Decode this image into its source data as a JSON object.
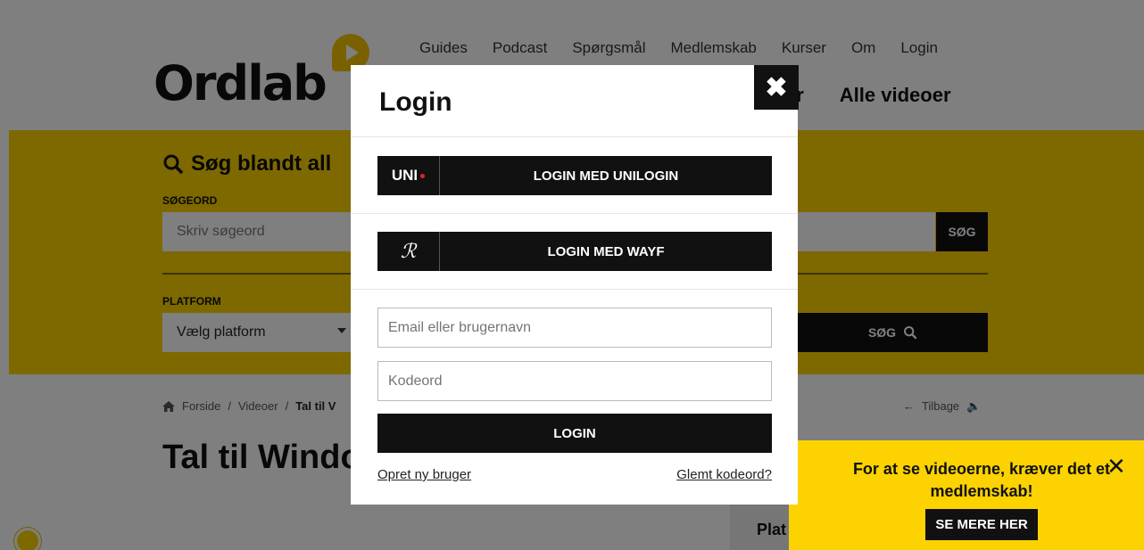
{
  "header": {
    "logo": "Ordlab",
    "topnav": [
      "Guides",
      "Podcast",
      "Spørgsmål",
      "Medlemskab",
      "Kurser",
      "Om",
      "Login"
    ],
    "subnav_partial": "er",
    "subnav_videos": "Alle videoer"
  },
  "search": {
    "title": "Søg blandt all",
    "keyword_label": "SØGEORD",
    "keyword_placeholder": "Skriv søgeord",
    "search_button": "SØG",
    "platform_label": "PLATFORM",
    "platform_value": "Vælg platform",
    "search_button_2": "SØG"
  },
  "breadcrumb": {
    "home": "Forside",
    "sep": "/",
    "videos": "Videoer",
    "current": "Tal til V"
  },
  "back": {
    "label": "Tilbage"
  },
  "page_title": "Tal til Windo",
  "sidebar": {
    "label": "Plat"
  },
  "modal": {
    "title": "Login",
    "close": "✖",
    "unilogin_icon": "UNI",
    "unilogin_label": "LOGIN MED UNILOGIN",
    "wayf_icon": "ℛ",
    "wayf_label": "LOGIN MED WAYF",
    "email_placeholder": "Email eller brugernavn",
    "password_placeholder": "Kodeord",
    "login_button": "LOGIN",
    "create_user": "Opret ny bruger",
    "forgot_password": "Glemt kodeord?"
  },
  "promo": {
    "text": "For at se videoerne, kræver det et medlemskab!",
    "button": "SE MERE HER",
    "close": "✕"
  },
  "colors": {
    "brand_yellow": "#fcd200",
    "dark": "#111111",
    "unilogin_dot": "#e2232a"
  }
}
